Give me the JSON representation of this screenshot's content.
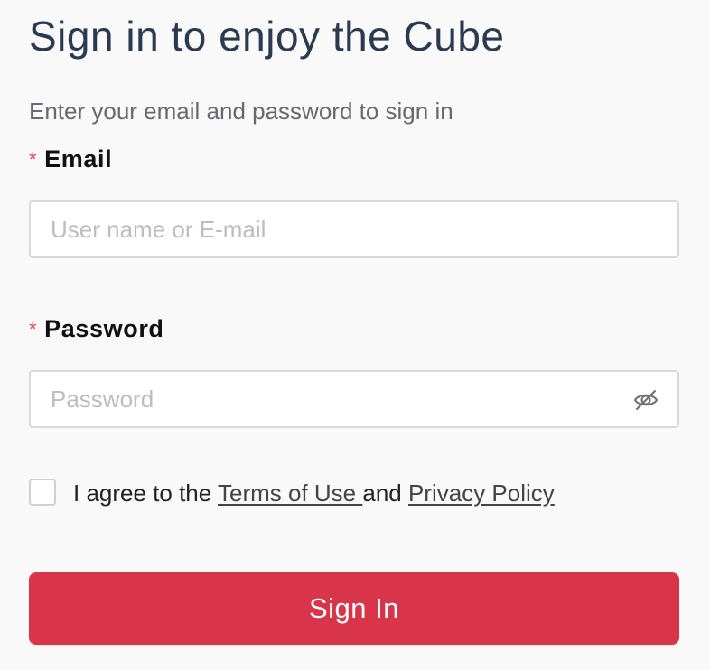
{
  "page": {
    "title": "Sign in to enjoy the Cube",
    "subtitle": "Enter your email and password to sign in"
  },
  "form": {
    "required_mark": "*",
    "email": {
      "label": "Email",
      "value": "",
      "placeholder": "User name or E-mail"
    },
    "password": {
      "label": "Password",
      "value": "",
      "placeholder": "Password",
      "visibility_icon": "eye-off-icon"
    },
    "agreement": {
      "checked": false,
      "prefix": "I agree to the ",
      "terms_link": "Terms of Use ",
      "conjunction": "and ",
      "privacy_link": "Privacy Policy"
    },
    "submit_label": "Sign In"
  },
  "colors": {
    "title": "#2b3a4f",
    "required_mark": "#e2454f",
    "button_background": "#d8344a",
    "page_background": "#f9f9f9"
  }
}
